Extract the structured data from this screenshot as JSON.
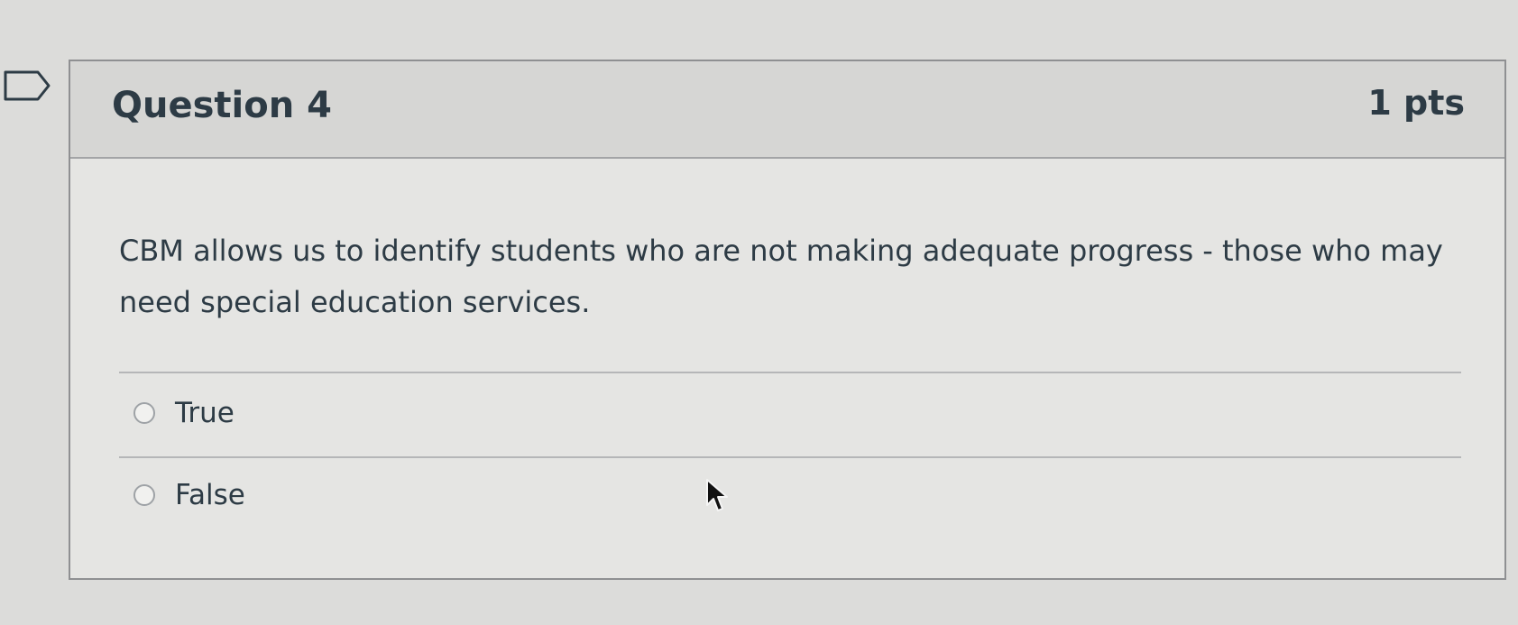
{
  "question": {
    "title": "Question 4",
    "points": "1 pts",
    "text": "CBM allows us to identify students who are not making adequate progress - those who may need special education services.",
    "answers": [
      {
        "label": "True",
        "selected": false
      },
      {
        "label": "False",
        "selected": false
      }
    ]
  },
  "icons": {
    "flag": "flag-outline-icon",
    "cursor": "mouse-pointer-icon"
  },
  "colors": {
    "text": "#2d3b45",
    "header_bg": "#d6d6d4",
    "card_bg": "#e5e5e3",
    "border": "#8f9092"
  }
}
